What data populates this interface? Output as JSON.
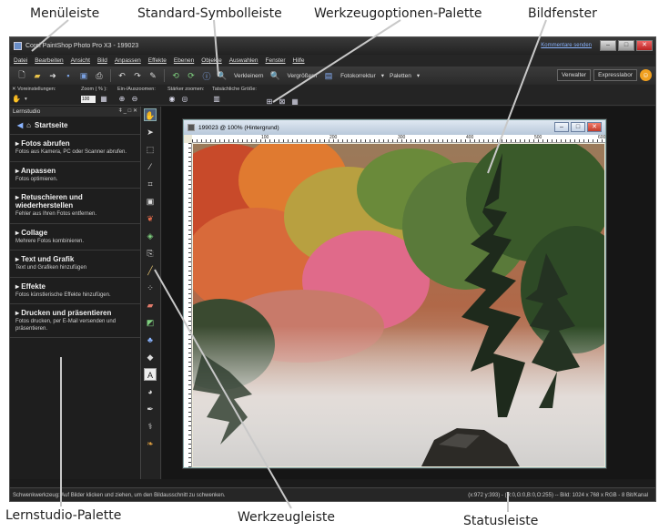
{
  "callouts": {
    "menuleiste": "Menüleiste",
    "standard": "Standard-Symbolleiste",
    "werkzeugoptionen": "Werkzeugoptionen-Palette",
    "bildfenster": "Bildfenster",
    "lernstudio": "Lernstudio-Palette",
    "werkzeugleiste": "Werkzeugleiste",
    "statusleiste": "Statusleiste"
  },
  "app": {
    "title": "Corel PaintShop Photo Pro X3 - 199023",
    "kommentar_link": "Kommentare senden"
  },
  "menu": [
    "Datei",
    "Bearbeiten",
    "Ansicht",
    "Bild",
    "Anpassen",
    "Effekte",
    "Ebenen",
    "Objekte",
    "Auswahlen",
    "Fenster",
    "Hilfe"
  ],
  "toolbar": {
    "verkleinern": "Verkleinern",
    "vergroessern": "Vergrößern",
    "fotokorrektur": "Fotokorrektur",
    "paletten": "Paletten",
    "verwalter": "Verwalter",
    "expresslabor": "Expresslabor"
  },
  "options": {
    "voreinstellungen": "Voreinstellungen:",
    "zoom_label": "Zoom ( % ):",
    "zoom_value": "100",
    "ein_aus": "Ein-/Auszoomen:",
    "staerker": "Stärker zoomen:",
    "tatsaechlich": "Tatsächliche Größe:"
  },
  "learning": {
    "title": "Lernstudio",
    "home": "Startseite",
    "sections": [
      {
        "title": "Fotos abrufen",
        "desc": "Fotos aus Kamera, PC oder Scanner abrufen."
      },
      {
        "title": "Anpassen",
        "desc": "Fotos optimieren."
      },
      {
        "title": "Retuschieren und wiederherstellen",
        "desc": "Fehler aus Ihren Fotos entfernen."
      },
      {
        "title": "Collage",
        "desc": "Mehrere Fotos kombinieren."
      },
      {
        "title": "Text und Grafik",
        "desc": "Text und Grafiken hinzufügen"
      },
      {
        "title": "Effekte",
        "desc": "Fotos künstlerische Effekte hinzufügen."
      },
      {
        "title": "Drucken und präsentieren",
        "desc": "Fotos drucken, per E-Mail versenden und präsentieren."
      }
    ]
  },
  "image_window": {
    "title": "199023 @ 100% (Hintergrund)",
    "ruler_labels": [
      "100",
      "200",
      "300",
      "400",
      "500",
      "600"
    ]
  },
  "status": {
    "left": "Schwenkwerkzeug: Auf Bilder klicken und ziehen, um den Bildausschnitt zu schwenken.",
    "right": "(x:972 y:393) - (R:0,G:0,B:0,O:255) -- Bild: 1024 x 768 x RGB - 8 Bit/Kanal"
  }
}
